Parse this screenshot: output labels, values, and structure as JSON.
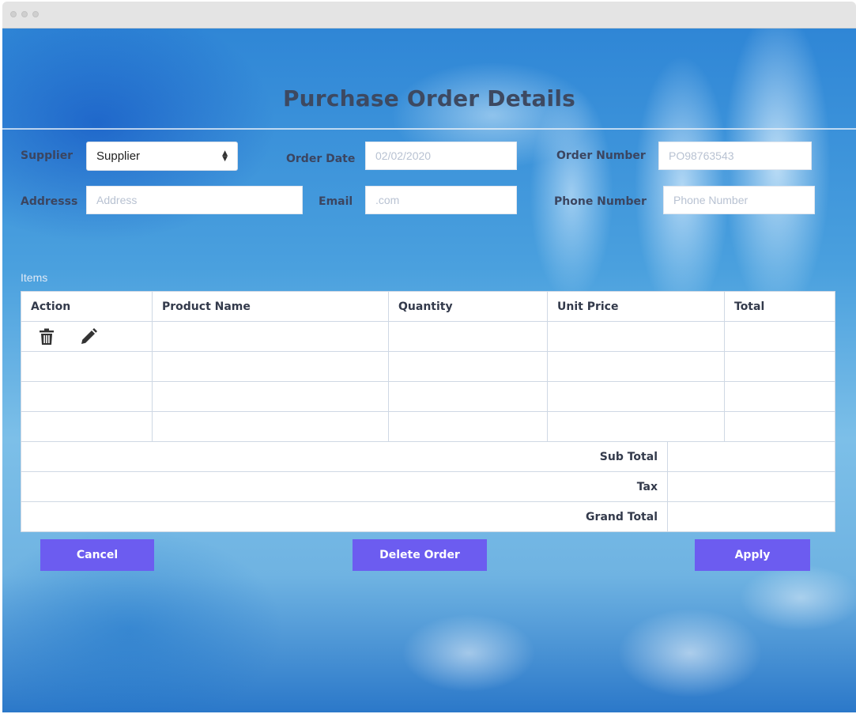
{
  "page": {
    "title": "Purchase Order Details"
  },
  "form": {
    "supplier": {
      "label": "Supplier",
      "selected": "Supplier"
    },
    "order_date": {
      "label": "Order Date",
      "placeholder": "02/02/2020"
    },
    "order_number": {
      "label": "Order Number",
      "placeholder": "PO98763543"
    },
    "address": {
      "label": "Addresss",
      "placeholder": "Address"
    },
    "email": {
      "label": "Email",
      "placeholder": ".com"
    },
    "phone": {
      "label": "Phone Number",
      "placeholder": "Phone Number"
    }
  },
  "items": {
    "label": "Items",
    "columns": [
      "Action",
      "Product Name",
      "Quantity",
      "Unit Price",
      "Total"
    ],
    "row_icons": [
      "trash-icon",
      "pencil-icon"
    ],
    "summary": [
      "Sub Total",
      "Tax",
      "Grand Total"
    ]
  },
  "buttons": {
    "cancel": "Cancel",
    "delete": "Delete Order",
    "apply": "Apply"
  },
  "colors": {
    "button": "#6c5cf0",
    "label": "#3b4560",
    "title": "#3d4961"
  }
}
